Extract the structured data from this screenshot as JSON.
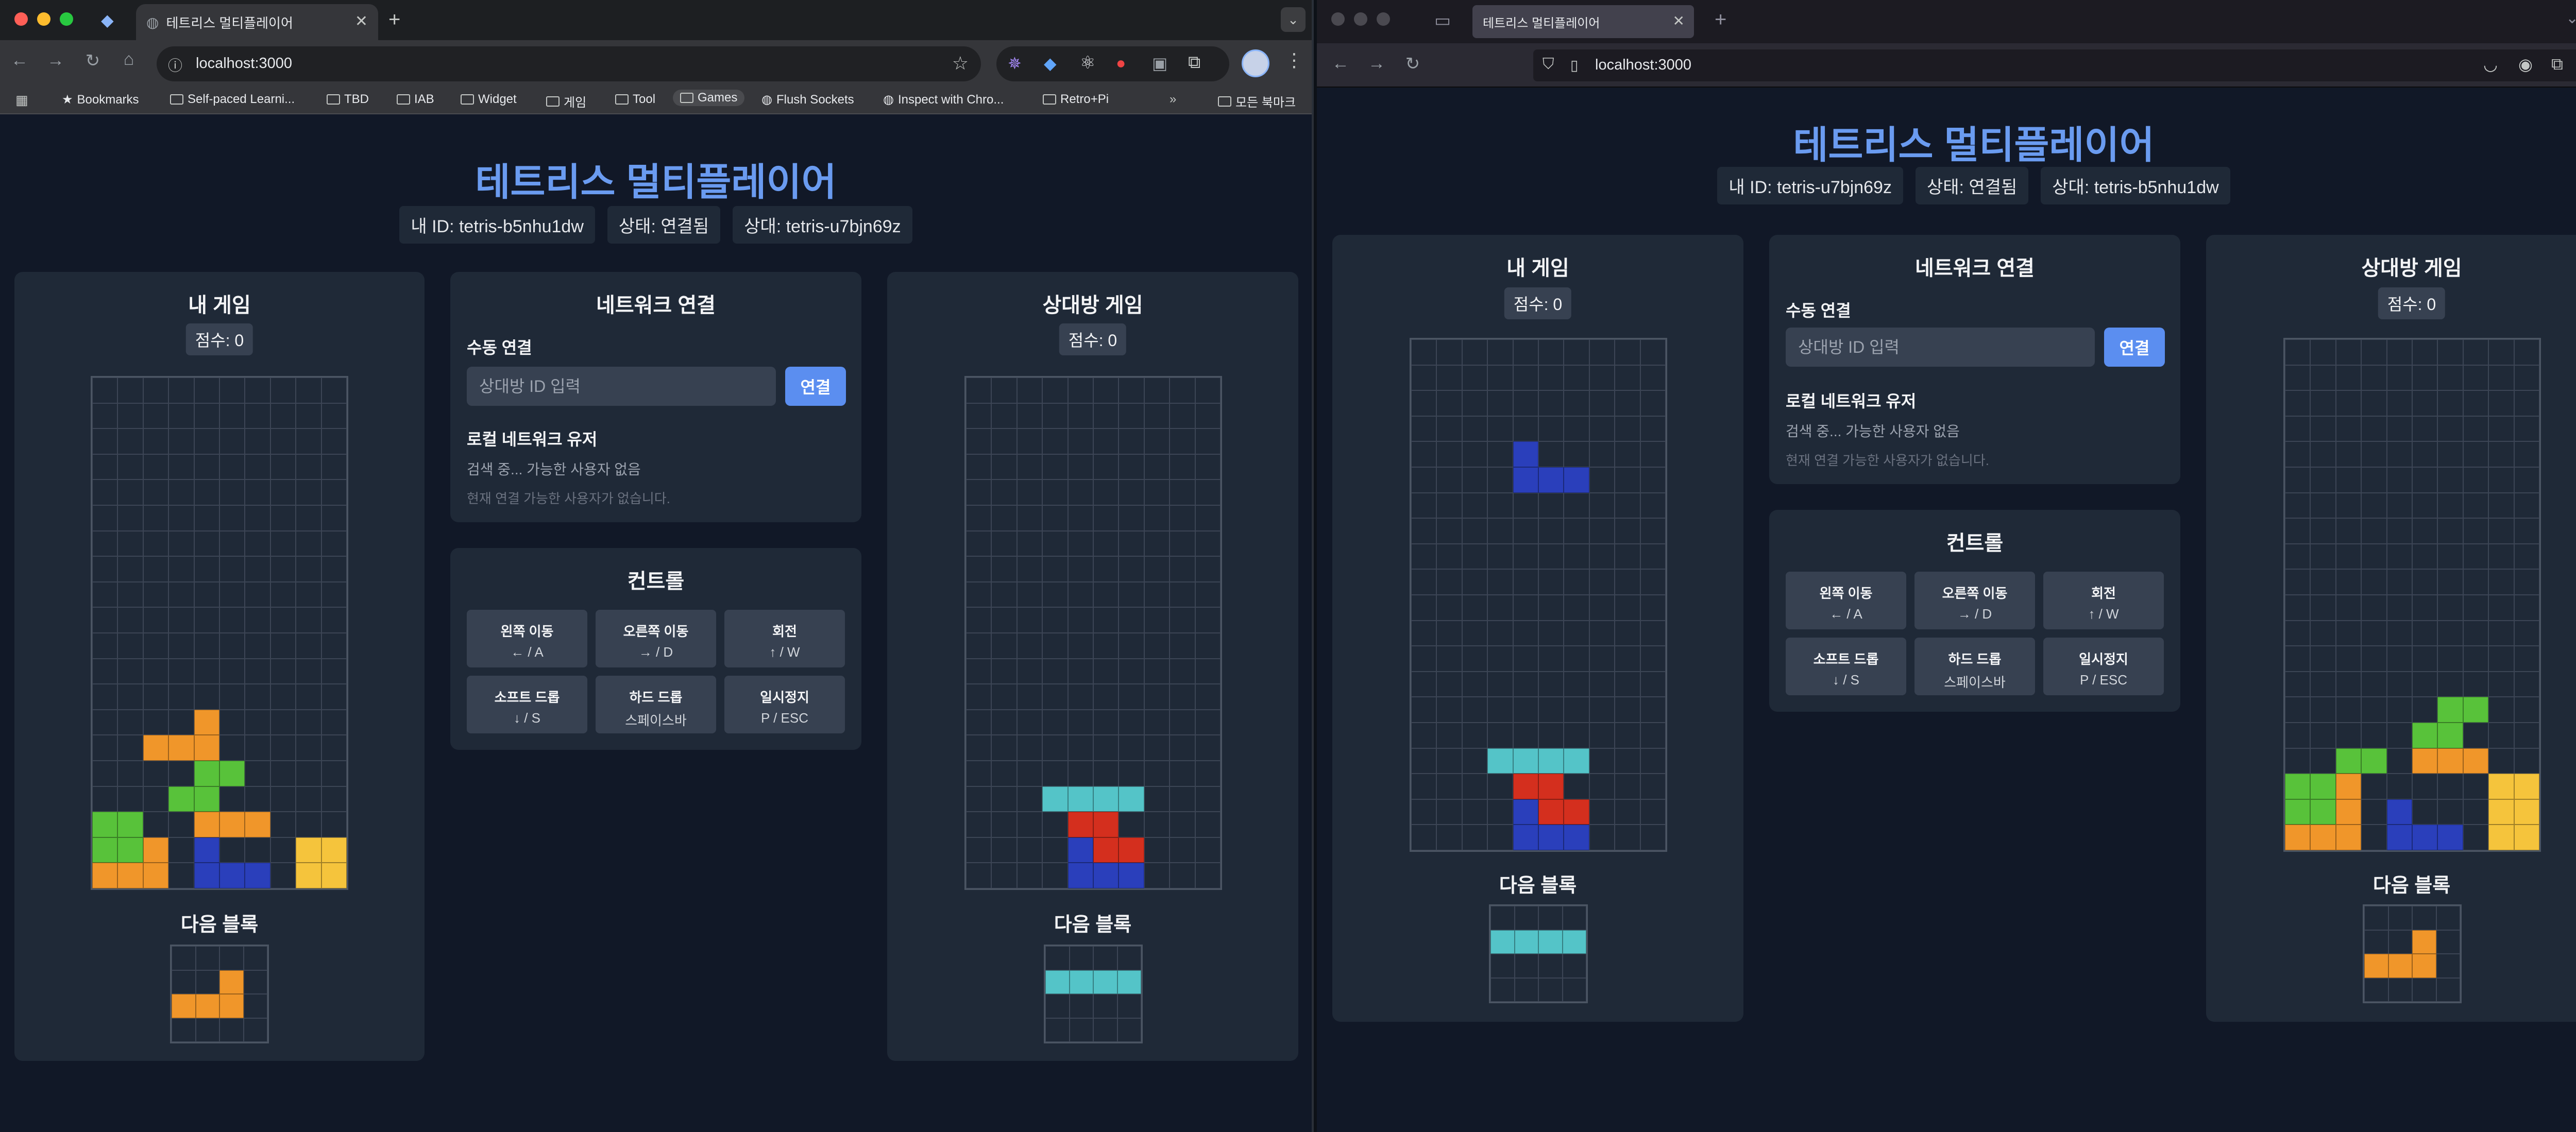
{
  "chrome": {
    "tab_title": "테트리스 멀티플레이어",
    "url": "localhost:3000",
    "bookmarks": [
      "Bookmarks",
      "Self-paced Learni...",
      "TBD",
      "IAB",
      "Widget",
      "게임",
      "Tool",
      "Games",
      "Flush Sockets",
      "Inspect with Chro...",
      "Retro+Pi",
      "모든 북마크"
    ]
  },
  "firefox": {
    "tab_title": "테트리스 멀티플레이어",
    "url": "localhost:3000"
  },
  "app": {
    "title": "테트리스 멀티플레이어",
    "my_game": "내 게임",
    "opponent_game": "상대방 게임",
    "next_block": "다음 블록",
    "network_title": "네트워크 연결",
    "manual_connect": "수동 연결",
    "input_placeholder": "상대방 ID 입력",
    "connect_button": "연결",
    "local_users": "로컬 네트워크 유저",
    "searching": "검색 중... 가능한 사용자 없음",
    "no_users": "현재 연결 가능한 사용자가 없습니다.",
    "controls_title": "컨트롤",
    "controls": [
      {
        "label": "왼쪽 이동",
        "key": "← / A"
      },
      {
        "label": "오른쪽 이동",
        "key": "→ / D"
      },
      {
        "label": "회전",
        "key": "↑ / W"
      },
      {
        "label": "소프트 드롭",
        "key": "↓ / S"
      },
      {
        "label": "하드 드롭",
        "key": "스페이스바"
      },
      {
        "label": "일시정지",
        "key": "P / ESC"
      }
    ]
  },
  "colors": {
    "O": "#f5c43c",
    "L": "#f0962a",
    "S": "#58c23a",
    "Z": "#d42f1e",
    "J": "#2a3fbb",
    "I": "#54c4c8",
    "T": "#9b4bd6"
  },
  "left": {
    "my_id": "내 ID: tetris-b5nhu1dw",
    "status": "상태: 연결됨",
    "peer": "상대: tetris-u7bjn69z",
    "my_score": "점수: 0",
    "opp_score": "점수: 0",
    "my_board": [
      "..........",
      "..........",
      "..........",
      "..........",
      "..........",
      "..........",
      "..........",
      "..........",
      "..........",
      "..........",
      "..........",
      "..........",
      "..........",
      "....L.....",
      "..LLL.....",
      "....SS....",
      "...SS.....",
      "SS..LLL...",
      "SSL.J...OO",
      "LLL.JJJ.OO"
    ],
    "my_next": [
      "....",
      "..L.",
      "LLL.",
      "...."
    ],
    "opp_board": [
      "..........",
      "..........",
      "..........",
      "..........",
      "..........",
      "..........",
      "..........",
      "..........",
      "..........",
      "..........",
      "..........",
      "..........",
      "..........",
      "..........",
      "..........",
      "..........",
      "...IIII...",
      "....ZZ....",
      "....JZZ...",
      "....JJJ..."
    ],
    "opp_next": [
      "....",
      "IIII",
      "....",
      "...."
    ]
  },
  "right": {
    "my_id": "내 ID: tetris-u7bjn69z",
    "status": "상태: 연결됨",
    "peer": "상대: tetris-b5nhu1dw",
    "my_score": "점수: 0",
    "opp_score": "점수: 0",
    "my_board": [
      "..........",
      "..........",
      "..........",
      "..........",
      "....J.....",
      "....JJJ...",
      "..........",
      "..........",
      "..........",
      "..........",
      "..........",
      "..........",
      "..........",
      "..........",
      "..........",
      "..........",
      "...IIII...",
      "....ZZ....",
      "....JZZ...",
      "....JJJ..."
    ],
    "my_next": [
      "....",
      "IIII",
      "....",
      "...."
    ],
    "opp_board": [
      "..........",
      "..........",
      "..........",
      "..........",
      "..........",
      "..........",
      "..........",
      "..........",
      "..........",
      "..........",
      "..........",
      "..........",
      "..........",
      "..........",
      "......SS..",
      ".....SS...",
      "..SS.LLL..",
      "SSL.....OO",
      "SSL.J...OO",
      "LLL.JJJ.OO"
    ],
    "opp_next": [
      "....",
      "..L.",
      "LLL.",
      "...."
    ]
  }
}
